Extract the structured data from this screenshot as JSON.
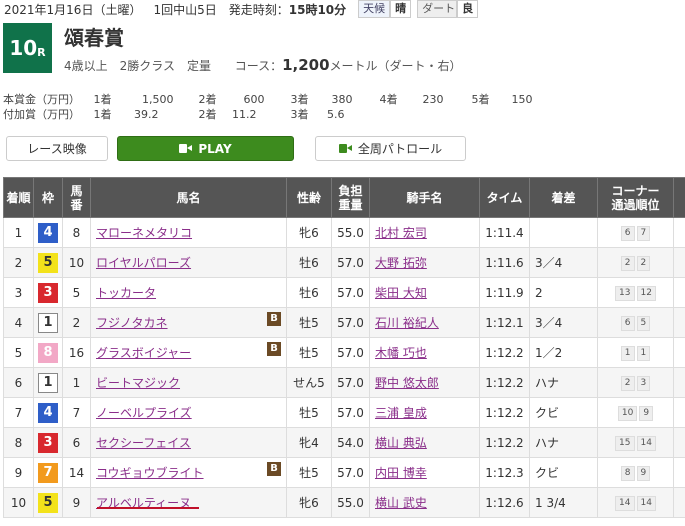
{
  "header": {
    "date": "2021年1月16日（土曜）",
    "meeting": "1回中山5日",
    "post_time_label": "発走時刻：",
    "post_time": "15時10分",
    "weather_label": "天候",
    "weather": "晴",
    "track_label": "ダート",
    "track": "良"
  },
  "race": {
    "number": "10",
    "number_suffix": "R",
    "name": "頌春賞",
    "conditions": "4歳以上　2勝クラス　定量",
    "course_label": "コース：",
    "distance": "1,200",
    "distance_unit": "メートル（ダート・右）"
  },
  "prize": {
    "main_label": "本賞金（万円）",
    "main": [
      {
        "place": "1着",
        "amount": "1,500"
      },
      {
        "place": "2着",
        "amount": "600"
      },
      {
        "place": "3着",
        "amount": "380"
      },
      {
        "place": "4着",
        "amount": "230"
      },
      {
        "place": "5着",
        "amount": "150"
      }
    ],
    "extra_label": "付加賞（万円）",
    "extra": [
      {
        "place": "1着",
        "amount": "39.2"
      },
      {
        "place": "2着",
        "amount": "11.2"
      },
      {
        "place": "3着",
        "amount": "5.6"
      }
    ]
  },
  "buttons": {
    "video": "レース映像",
    "play": "PLAY",
    "patrol": "全周パトロール"
  },
  "table": {
    "headers": {
      "place": "着順",
      "waku": "枠",
      "umaban_1": "馬",
      "umaban_2": "番",
      "horse": "馬名",
      "sexage": "性齢",
      "weight_1": "負担",
      "weight_2": "重量",
      "jockey": "騎手名",
      "time": "タイム",
      "margin": "着差",
      "corner_1": "コーナー",
      "corner_2": "通過順位"
    },
    "rows": [
      {
        "place": "1",
        "waku": "4",
        "num": "8",
        "horse": "マローネメタリコ",
        "blinker": "",
        "sexage": "牝6",
        "weight": "55.0",
        "jockey": "北村 宏司",
        "time": "1:11.4",
        "margin": "",
        "c1": "6",
        "c2": "7"
      },
      {
        "place": "2",
        "waku": "5",
        "num": "10",
        "horse": "ロイヤルパローズ",
        "blinker": "",
        "sexage": "牡6",
        "weight": "57.0",
        "jockey": "大野 拓弥",
        "time": "1:11.6",
        "margin": "3／4",
        "c1": "2",
        "c2": "2"
      },
      {
        "place": "3",
        "waku": "3",
        "num": "5",
        "horse": "トッカータ",
        "blinker": "",
        "sexage": "牡6",
        "weight": "57.0",
        "jockey": "柴田 大知",
        "time": "1:11.9",
        "margin": "2",
        "c1": "13",
        "c2": "12"
      },
      {
        "place": "4",
        "waku": "1",
        "num": "2",
        "horse": "フジノタカネ",
        "blinker": "B",
        "sexage": "牡5",
        "weight": "57.0",
        "jockey": "石川 裕紀人",
        "time": "1:12.1",
        "margin": "3／4",
        "c1": "6",
        "c2": "5"
      },
      {
        "place": "5",
        "waku": "8",
        "num": "16",
        "horse": "グラスボイジャー",
        "blinker": "B",
        "sexage": "牡5",
        "weight": "57.0",
        "jockey": "木幡 巧也",
        "time": "1:12.2",
        "margin": "1／2",
        "c1": "1",
        "c2": "1"
      },
      {
        "place": "6",
        "waku": "1",
        "num": "1",
        "horse": "ビートマジック",
        "blinker": "",
        "sexage": "せん5",
        "weight": "57.0",
        "jockey": "野中 悠太郎",
        "time": "1:12.2",
        "margin": "ハナ",
        "c1": "2",
        "c2": "3"
      },
      {
        "place": "7",
        "waku": "4",
        "num": "7",
        "horse": "ノーベルプライズ",
        "blinker": "",
        "sexage": "牡5",
        "weight": "57.0",
        "jockey": "三浦 皇成",
        "time": "1:12.2",
        "margin": "クビ",
        "c1": "10",
        "c2": "9"
      },
      {
        "place": "8",
        "waku": "3",
        "num": "6",
        "horse": "セクシーフェイス",
        "blinker": "",
        "sexage": "牝4",
        "weight": "54.0",
        "jockey": "横山 典弘",
        "time": "1:12.2",
        "margin": "ハナ",
        "c1": "15",
        "c2": "14"
      },
      {
        "place": "9",
        "waku": "7",
        "num": "14",
        "horse": "コウギョウブライト",
        "blinker": "B",
        "sexage": "牡5",
        "weight": "57.0",
        "jockey": "内田 博幸",
        "time": "1:12.3",
        "margin": "クビ",
        "c1": "8",
        "c2": "9"
      },
      {
        "place": "10",
        "waku": "5",
        "num": "9",
        "horse": "アルベルティーヌ",
        "blinker": "",
        "sexage": "牝6",
        "weight": "55.0",
        "jockey": "横山 武史",
        "time": "1:12.6",
        "margin": "1 3/4",
        "c1": "14",
        "c2": "14"
      }
    ]
  }
}
